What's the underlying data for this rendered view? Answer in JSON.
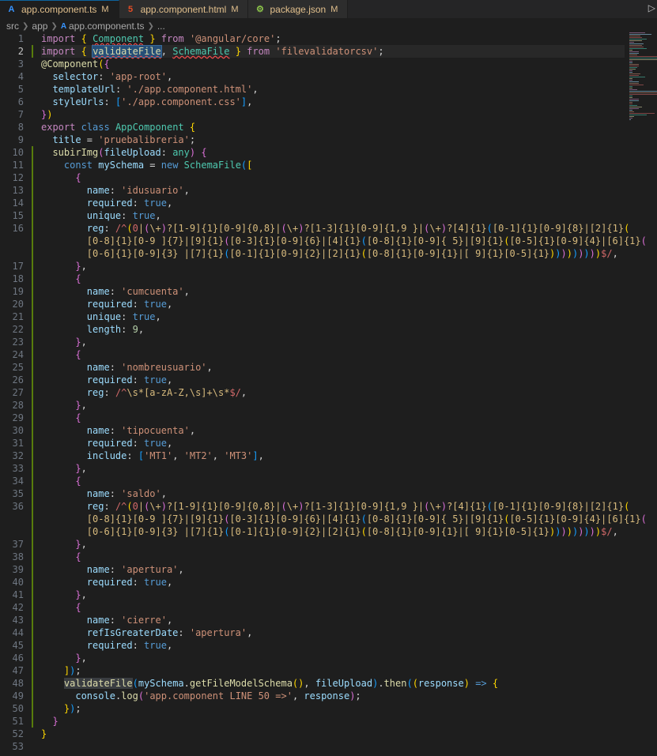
{
  "tabs": [
    {
      "label": "app.component.ts",
      "badge": "M",
      "icon": "angular-icon",
      "active": true
    },
    {
      "label": "app.component.html",
      "badge": "M",
      "icon": "html-icon",
      "active": false
    },
    {
      "label": "package.json",
      "badge": "M",
      "icon": "json-icon",
      "active": false
    }
  ],
  "breadcrumb": [
    "src",
    "app",
    "app.component.ts",
    "..."
  ],
  "editor": {
    "current_line": 2,
    "line_numbers": [
      "1",
      "2",
      "3",
      "4",
      "5",
      "6",
      "7",
      "8",
      "9",
      "10",
      "11",
      "12",
      "13",
      "14",
      "15",
      "16",
      "",
      "",
      "17",
      "18",
      "19",
      "20",
      "21",
      "22",
      "23",
      "24",
      "25",
      "26",
      "27",
      "28",
      "29",
      "30",
      "31",
      "32",
      "33",
      "34",
      "35",
      "36",
      "",
      "",
      "37",
      "38",
      "39",
      "40",
      "41",
      "42",
      "43",
      "44",
      "45",
      "46",
      "47",
      "48",
      "49",
      "50",
      "51",
      "52",
      "53"
    ]
  },
  "colors": {
    "background": "#1e1e1e",
    "keyword": "#c586c0",
    "string": "#ce9178",
    "type": "#4ec9b0",
    "function": "#dcdcaa"
  }
}
